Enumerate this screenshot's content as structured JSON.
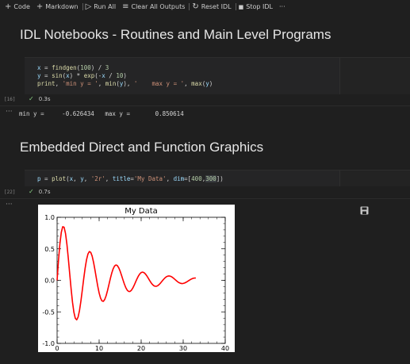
{
  "toolbar": {
    "items": [
      {
        "icon": "+",
        "label": "Code"
      },
      {
        "icon": "+",
        "label": "Markdown"
      },
      {
        "icon": "▷",
        "label": "Run All"
      },
      {
        "icon": "≡",
        "label": "Clear All Outputs"
      },
      {
        "icon": "↻",
        "label": "Reset IDL"
      },
      {
        "icon": "■",
        "label": "Stop IDL"
      }
    ],
    "more": "···"
  },
  "cells": {
    "heading1": "IDL Notebooks - Routines and Main Level Programs",
    "code1": {
      "exec_count": "[16]",
      "lines": [
        "x = findgen(100) / 3",
        "y = sin(x) * exp(-x / 10)",
        "print, 'min y = ', min(y), '    max y = ', max(y)"
      ],
      "status_time": "0.3s",
      "output_more": "···",
      "output": "min y =     -0.626434   max y =       0.850614"
    },
    "heading2": "Embedded Direct and Function Graphics",
    "code2": {
      "exec_count": "[22]",
      "line": "p = plot(x, y, '2r', title='My Data', dim=[400,300])",
      "status_time": "0.7s",
      "output_more": "···"
    }
  },
  "chart_data": {
    "type": "line",
    "title": "My Data",
    "xlabel": "",
    "ylabel": "",
    "xlim": [
      0,
      40
    ],
    "ylim": [
      -1.0,
      1.0
    ],
    "xticks": [
      "0",
      "10",
      "20",
      "30",
      "40"
    ],
    "yticks": [
      "-1.0",
      "-0.5",
      "0.0",
      "0.5",
      "1.0"
    ],
    "grid": false,
    "series": [
      {
        "name": "",
        "color": "#ff0000",
        "expression": "sin(x) * exp(-x / 10)",
        "x_start": 0,
        "x_step": 0.3333333,
        "count": 100
      }
    ]
  },
  "icons": {
    "save": "save-icon"
  }
}
